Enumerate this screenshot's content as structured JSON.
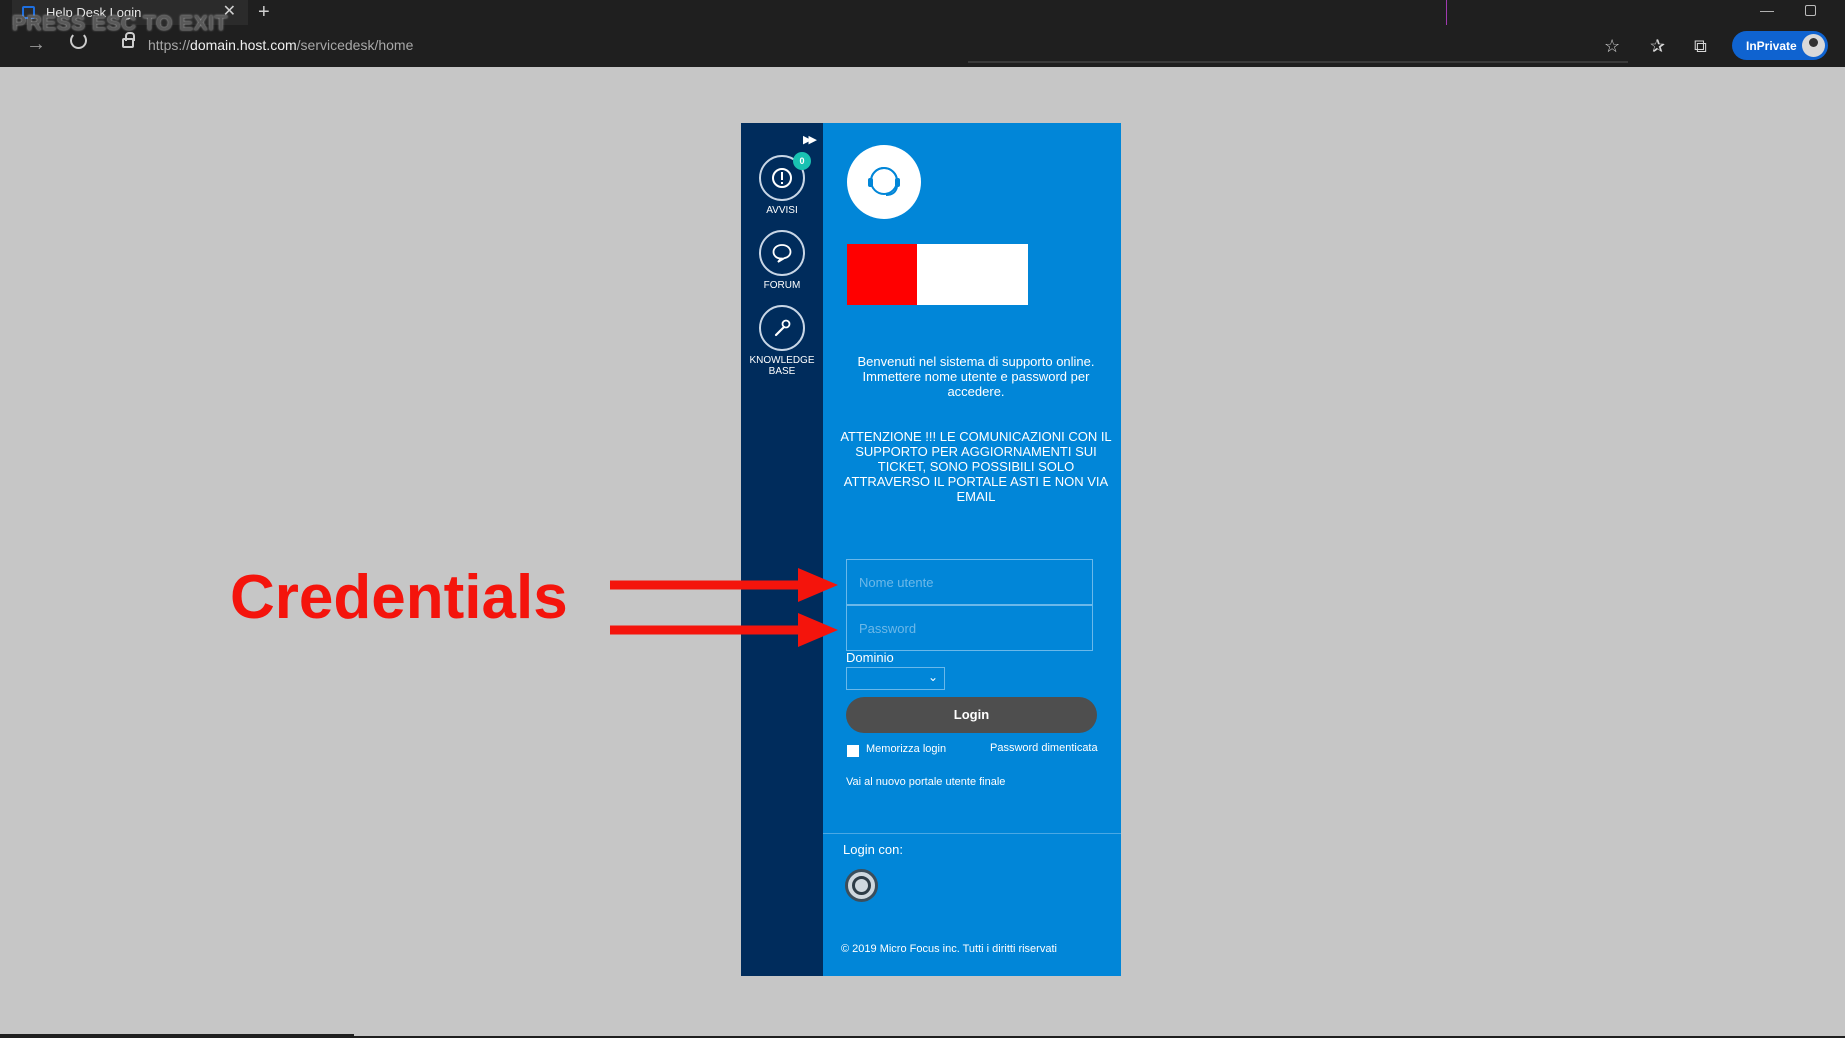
{
  "browser": {
    "tab_title": "Help Desk Login",
    "tab_close": "✕",
    "new_tab": "+",
    "url_prefix": "https://",
    "url_host": "domain.host.com",
    "url_path": "/servicedesk/home",
    "inprivate_label": "InPrivate",
    "overlay_text": "PRESS ESC TO EXIT"
  },
  "sidebar": {
    "collapse": "▶▶",
    "items": [
      {
        "label": "AVVISI",
        "badge": "0",
        "icon": "alert-icon"
      },
      {
        "label": "FORUM",
        "icon": "chat-bubble-icon"
      },
      {
        "label": "KNOWLEDGE BASE",
        "icon": "wrench-icon"
      }
    ]
  },
  "login": {
    "welcome": "Benvenuti nel sistema di supporto online. Immettere nome utente e password per accedere.",
    "warning": "ATTENZIONE !!! LE COMUNICAZIONI CON IL SUPPORTO PER AGGIORNAMENTI SUI TICKET, SONO POSSIBILI SOLO ATTRAVERSO IL PORTALE ASTI E NON VIA EMAIL",
    "username_placeholder": "Nome utente",
    "password_placeholder": "Password",
    "dominio_label": "Dominio",
    "dominio_value": "",
    "login_button": "Login",
    "remember_label": "Memorizza login",
    "forgot_password": "Password dimenticata",
    "new_portal_link": "Vai al nuovo portale utente finale",
    "login_with": "Login con:",
    "copyright": "© 2019 Micro Focus inc. Tutti i diritti riservati"
  },
  "annotation": {
    "label": "Credentials",
    "color": "#f4140c"
  },
  "colors": {
    "panel_blue": "#0186d8",
    "sidebar_navy": "#002c5c",
    "button_gray": "#4e4e4e",
    "brand_red": "#ff0000"
  }
}
